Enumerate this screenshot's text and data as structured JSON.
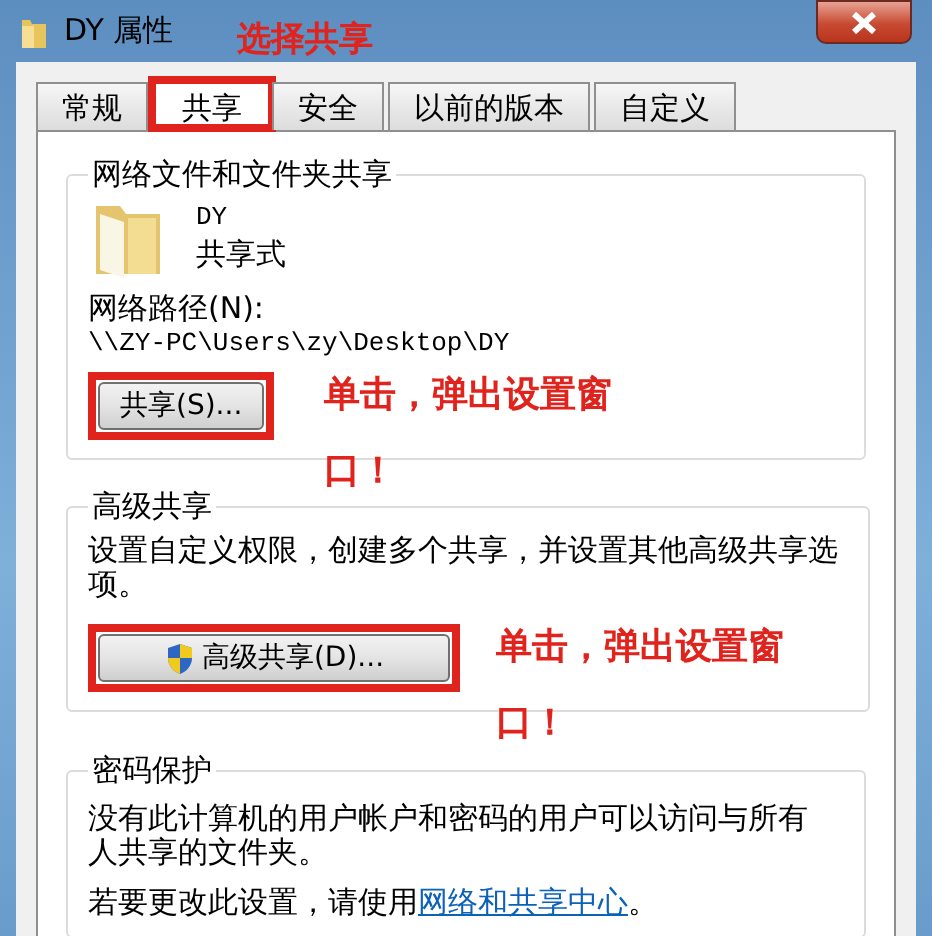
{
  "window": {
    "title": "DY 属性",
    "annotation": "选择共享"
  },
  "tabs": [
    {
      "label": "常规",
      "selected": false,
      "annotated": false
    },
    {
      "label": "共享",
      "selected": true,
      "annotated": true
    },
    {
      "label": "安全",
      "selected": false,
      "annotated": false
    },
    {
      "label": "以前的版本",
      "selected": false,
      "annotated": false
    },
    {
      "label": "自定义",
      "selected": false,
      "annotated": false
    }
  ],
  "sharing_group": {
    "title": "网络文件和文件夹共享",
    "folder_name": "DY",
    "status": "共享式",
    "path_label": "网络路径(N):",
    "path": "\\\\ZY-PC\\Users\\zy\\Desktop\\DY",
    "button": {
      "label": "共享(S)...",
      "annotated": true
    },
    "annotation": "单击，弹出设置窗口！"
  },
  "advanced_group": {
    "title": "高级共享",
    "description": "设置自定义权限，创建多个共享，并设置其他高级共享选项。",
    "button": {
      "label": "高级共享(D)...",
      "annotated": true
    },
    "annotation": "单击，弹出设置窗口！"
  },
  "password_group": {
    "title": "密码保护",
    "description": "没有此计算机的用户帐户和密码的用户可以访问与所有人共享的文件夹。",
    "instruction": "若要更改此设置，请使用",
    "link": "网络和共享中心",
    "instruction_end": "。"
  }
}
